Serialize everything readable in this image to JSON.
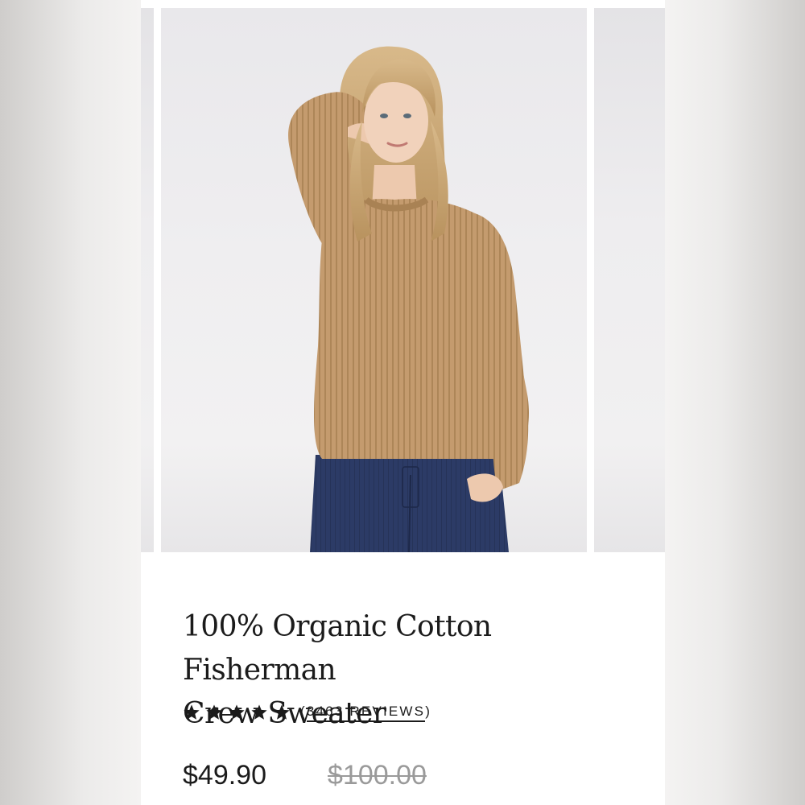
{
  "product": {
    "title_line1": "100% Organic Cotton Fisherman",
    "title_line2": "Crew Sweater",
    "rating": {
      "stars": 5,
      "max": 5
    },
    "reviews_open": "(",
    "reviews_label": "3463 REVIEWS",
    "reviews_close": ")",
    "price": "$49.90",
    "compare_price": "$100.00"
  },
  "colors": {
    "text": "#1b1b1b",
    "muted": "#9a9a9a",
    "sweater": "#c49b6e",
    "jeans": "#2c3b66"
  },
  "icons": {
    "star": "star-icon"
  }
}
